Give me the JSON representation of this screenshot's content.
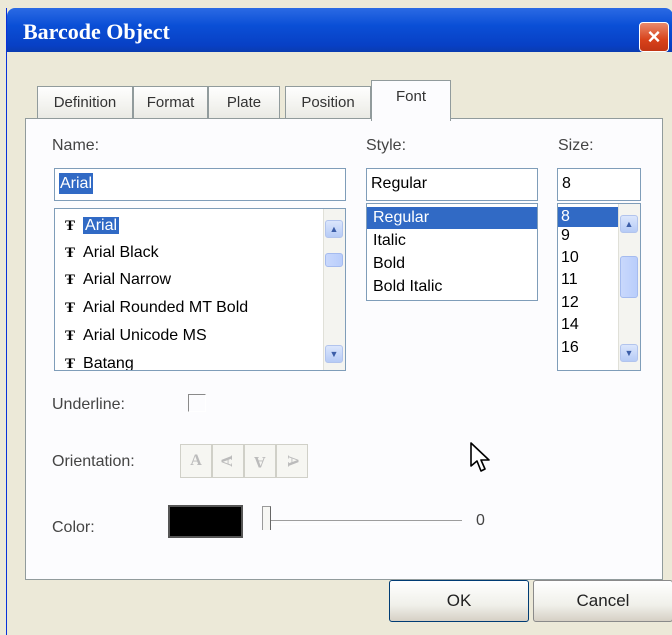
{
  "window": {
    "title": "Barcode Object",
    "close_glyph": "×"
  },
  "tabs": [
    {
      "label": "Definition",
      "active": false
    },
    {
      "label": "Format",
      "active": false
    },
    {
      "label": "Plate",
      "active": false
    },
    {
      "label": "Position",
      "active": false
    },
    {
      "label": "Font",
      "active": true
    }
  ],
  "name": {
    "label": "Name:",
    "value": "Arial",
    "selected_index": 0,
    "items": [
      "Arial",
      "Arial Black",
      "Arial Narrow",
      "Arial Rounded MT Bold",
      "Arial Unicode MS",
      "Batang"
    ]
  },
  "style": {
    "label": "Style:",
    "value": "Regular",
    "selected_index": 0,
    "items": [
      "Regular",
      "Italic",
      "Bold",
      "Bold Italic"
    ]
  },
  "size": {
    "label": "Size:",
    "value": "8",
    "selected_index": 0,
    "items": [
      "8",
      "9",
      "10",
      "11",
      "12",
      "14",
      "16"
    ]
  },
  "underline": {
    "label": "Underline:",
    "checked": false
  },
  "orientation": {
    "label": "Orientation:",
    "options": [
      "rotate-0",
      "rotate-90",
      "rotate-180",
      "rotate-270"
    ]
  },
  "color": {
    "label": "Color:",
    "value": "#000000",
    "slider_value": "0"
  },
  "buttons": {
    "ok": "OK",
    "cancel": "Cancel"
  }
}
